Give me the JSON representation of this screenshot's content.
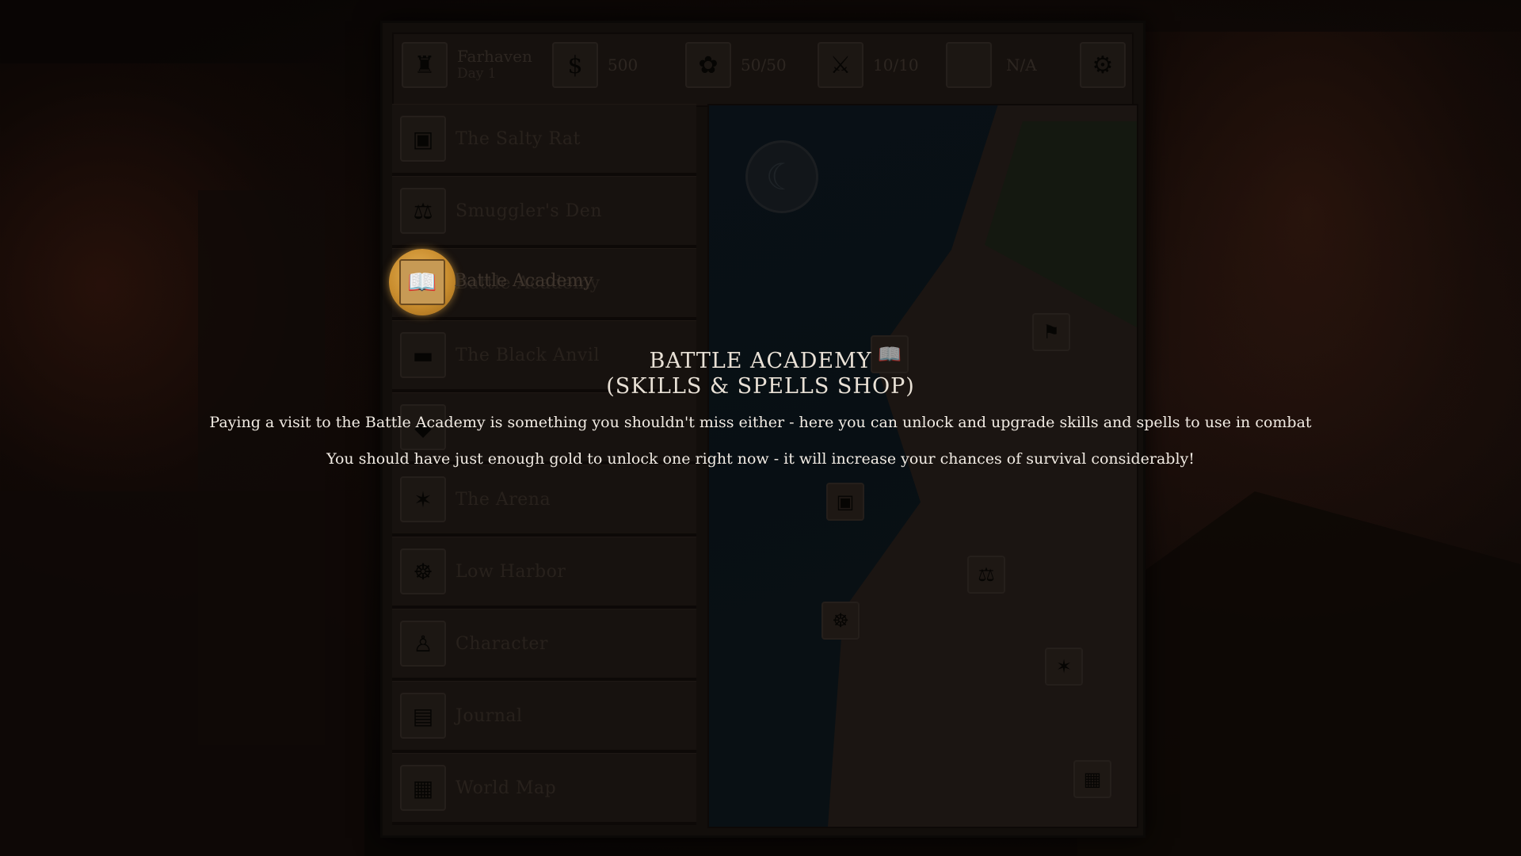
{
  "topbar": {
    "location": "Farhaven",
    "day": "Day 1",
    "gold": "500",
    "food": "50/50",
    "troops": "10/10",
    "extra": "N/A",
    "icons": [
      "castle-icon",
      "gold-bag-icon",
      "food-basket-icon",
      "sword-emblem-icon",
      "empty-slot-icon",
      "settings-gear-icon"
    ]
  },
  "nav": {
    "items": [
      {
        "label": "The Salty Rat",
        "icon": "tavern-icon"
      },
      {
        "label": "Smuggler's Den",
        "icon": "scales-icon"
      },
      {
        "label": "Battle Academy",
        "icon": "spellbook-icon"
      },
      {
        "label": "The Black Anvil",
        "icon": "anvil-icon"
      },
      {
        "label": "",
        "icon": "hidden-icon"
      },
      {
        "label": "The Arena",
        "icon": "arena-icon"
      },
      {
        "label": "Low Harbor",
        "icon": "ship-wheel-icon"
      },
      {
        "label": "Character",
        "icon": "character-icon"
      },
      {
        "label": "Journal",
        "icon": "journal-icon"
      },
      {
        "label": "World Map",
        "icon": "world-map-icon"
      }
    ]
  },
  "tutorial": {
    "title_line1": "BATTLE ACADEMY",
    "title_line2": "(SKILLS & SPELLS SHOP)",
    "line1": "Paying a visit to the Battle Academy is something you shouldn't miss either - here you can unlock and upgrade skills and spells to use in combat",
    "line2": "You should have just enough gold to unlock one right now - it will increase your chances of survival considerably!"
  },
  "colors": {
    "highlight": "#d9a040",
    "text": "#f2ece4"
  }
}
